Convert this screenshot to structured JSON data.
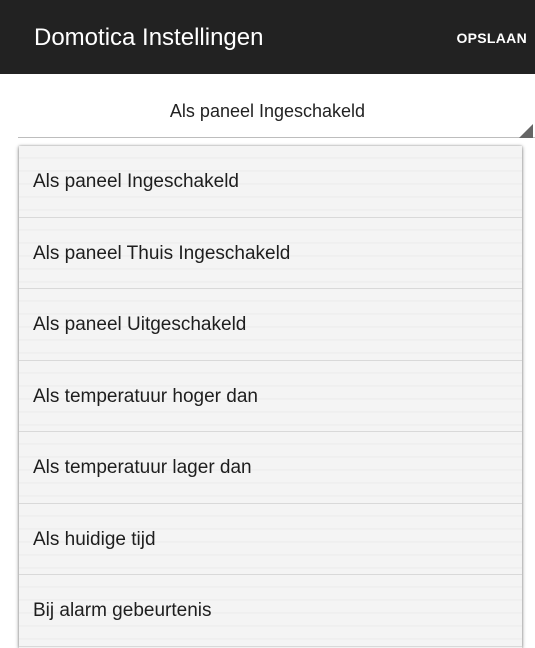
{
  "app_bar": {
    "title": "Domotica Instellingen",
    "save_label": "OPSLAAN",
    "background": "#222222"
  },
  "spinner": {
    "selected_value": "Als paneel Ingeschakeld"
  },
  "dropdown": {
    "items": [
      {
        "label": "Als paneel Ingeschakeld"
      },
      {
        "label": "Als paneel Thuis Ingeschakeld"
      },
      {
        "label": "Als paneel Uitgeschakeld"
      },
      {
        "label": "Als temperatuur hoger dan"
      },
      {
        "label": "Als temperatuur lager dan"
      },
      {
        "label": "Als huidige tijd"
      },
      {
        "label": "Bij alarm gebeurtenis"
      }
    ]
  }
}
